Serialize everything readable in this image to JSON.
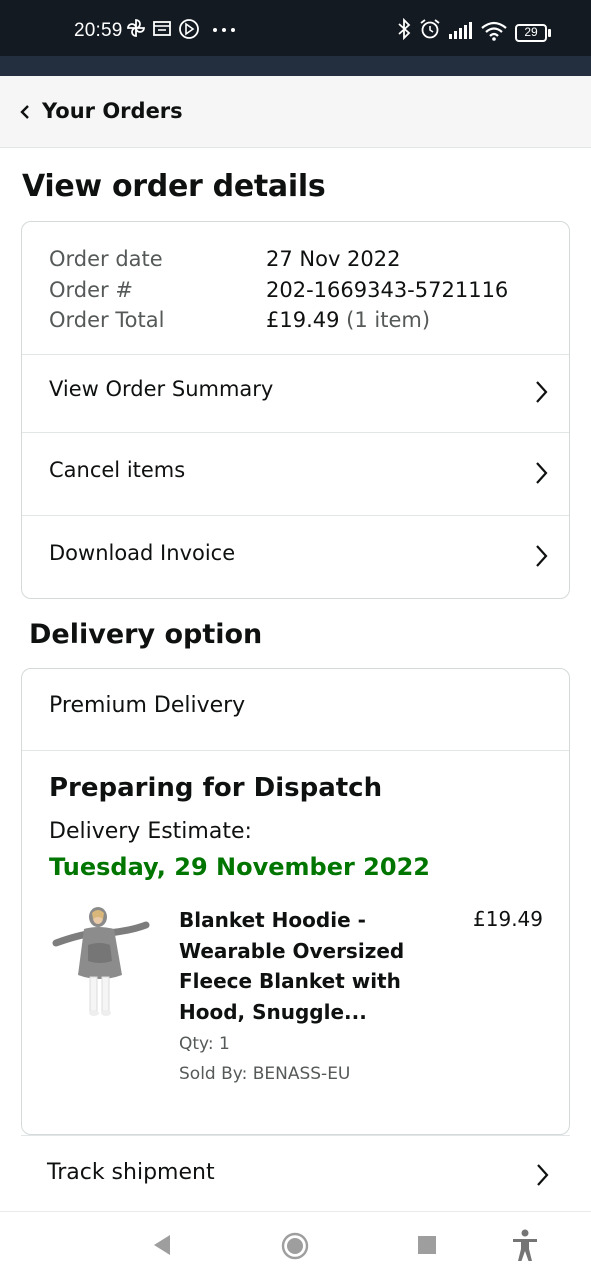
{
  "status_bar": {
    "time": "20:59",
    "battery": "29",
    "icons": [
      "pinwheel-icon",
      "calendar-icon",
      "compass-icon",
      "more-icon",
      "bluetooth-icon",
      "alarm-icon",
      "signal-icon",
      "wifi-icon",
      "battery-icon"
    ]
  },
  "header": {
    "back_label": "Your Orders"
  },
  "page": {
    "title": "View order details"
  },
  "order": {
    "labels": [
      "Order date",
      "Order #",
      "Order Total"
    ],
    "date": "27 Nov 2022",
    "number": "202-1669343-5721116",
    "total": "£19.49",
    "items_count": "(1 item)"
  },
  "actions": [
    {
      "label": "View Order Summary"
    },
    {
      "label": "Cancel items"
    },
    {
      "label": "Download Invoice"
    }
  ],
  "delivery": {
    "section_title": "Delivery option",
    "method": "Premium Delivery",
    "status": "Preparing for Dispatch",
    "estimate_label": "Delivery Estimate:",
    "estimate_date": "Tuesday, 29 November 2022",
    "status_color": "#007600"
  },
  "product": {
    "name_lines": [
      "Blanket Hoodie -",
      "Wearable Oversized",
      "Fleece Blanket with",
      "Hood, Snuggle..."
    ],
    "price": "£19.49",
    "qty": "Qty: 1",
    "seller": "Sold By: BENASS-EU"
  },
  "track": {
    "label": "Track shipment"
  },
  "nav": {
    "buttons": [
      "back-icon",
      "home-icon",
      "recents-icon",
      "accessibility-icon"
    ]
  }
}
